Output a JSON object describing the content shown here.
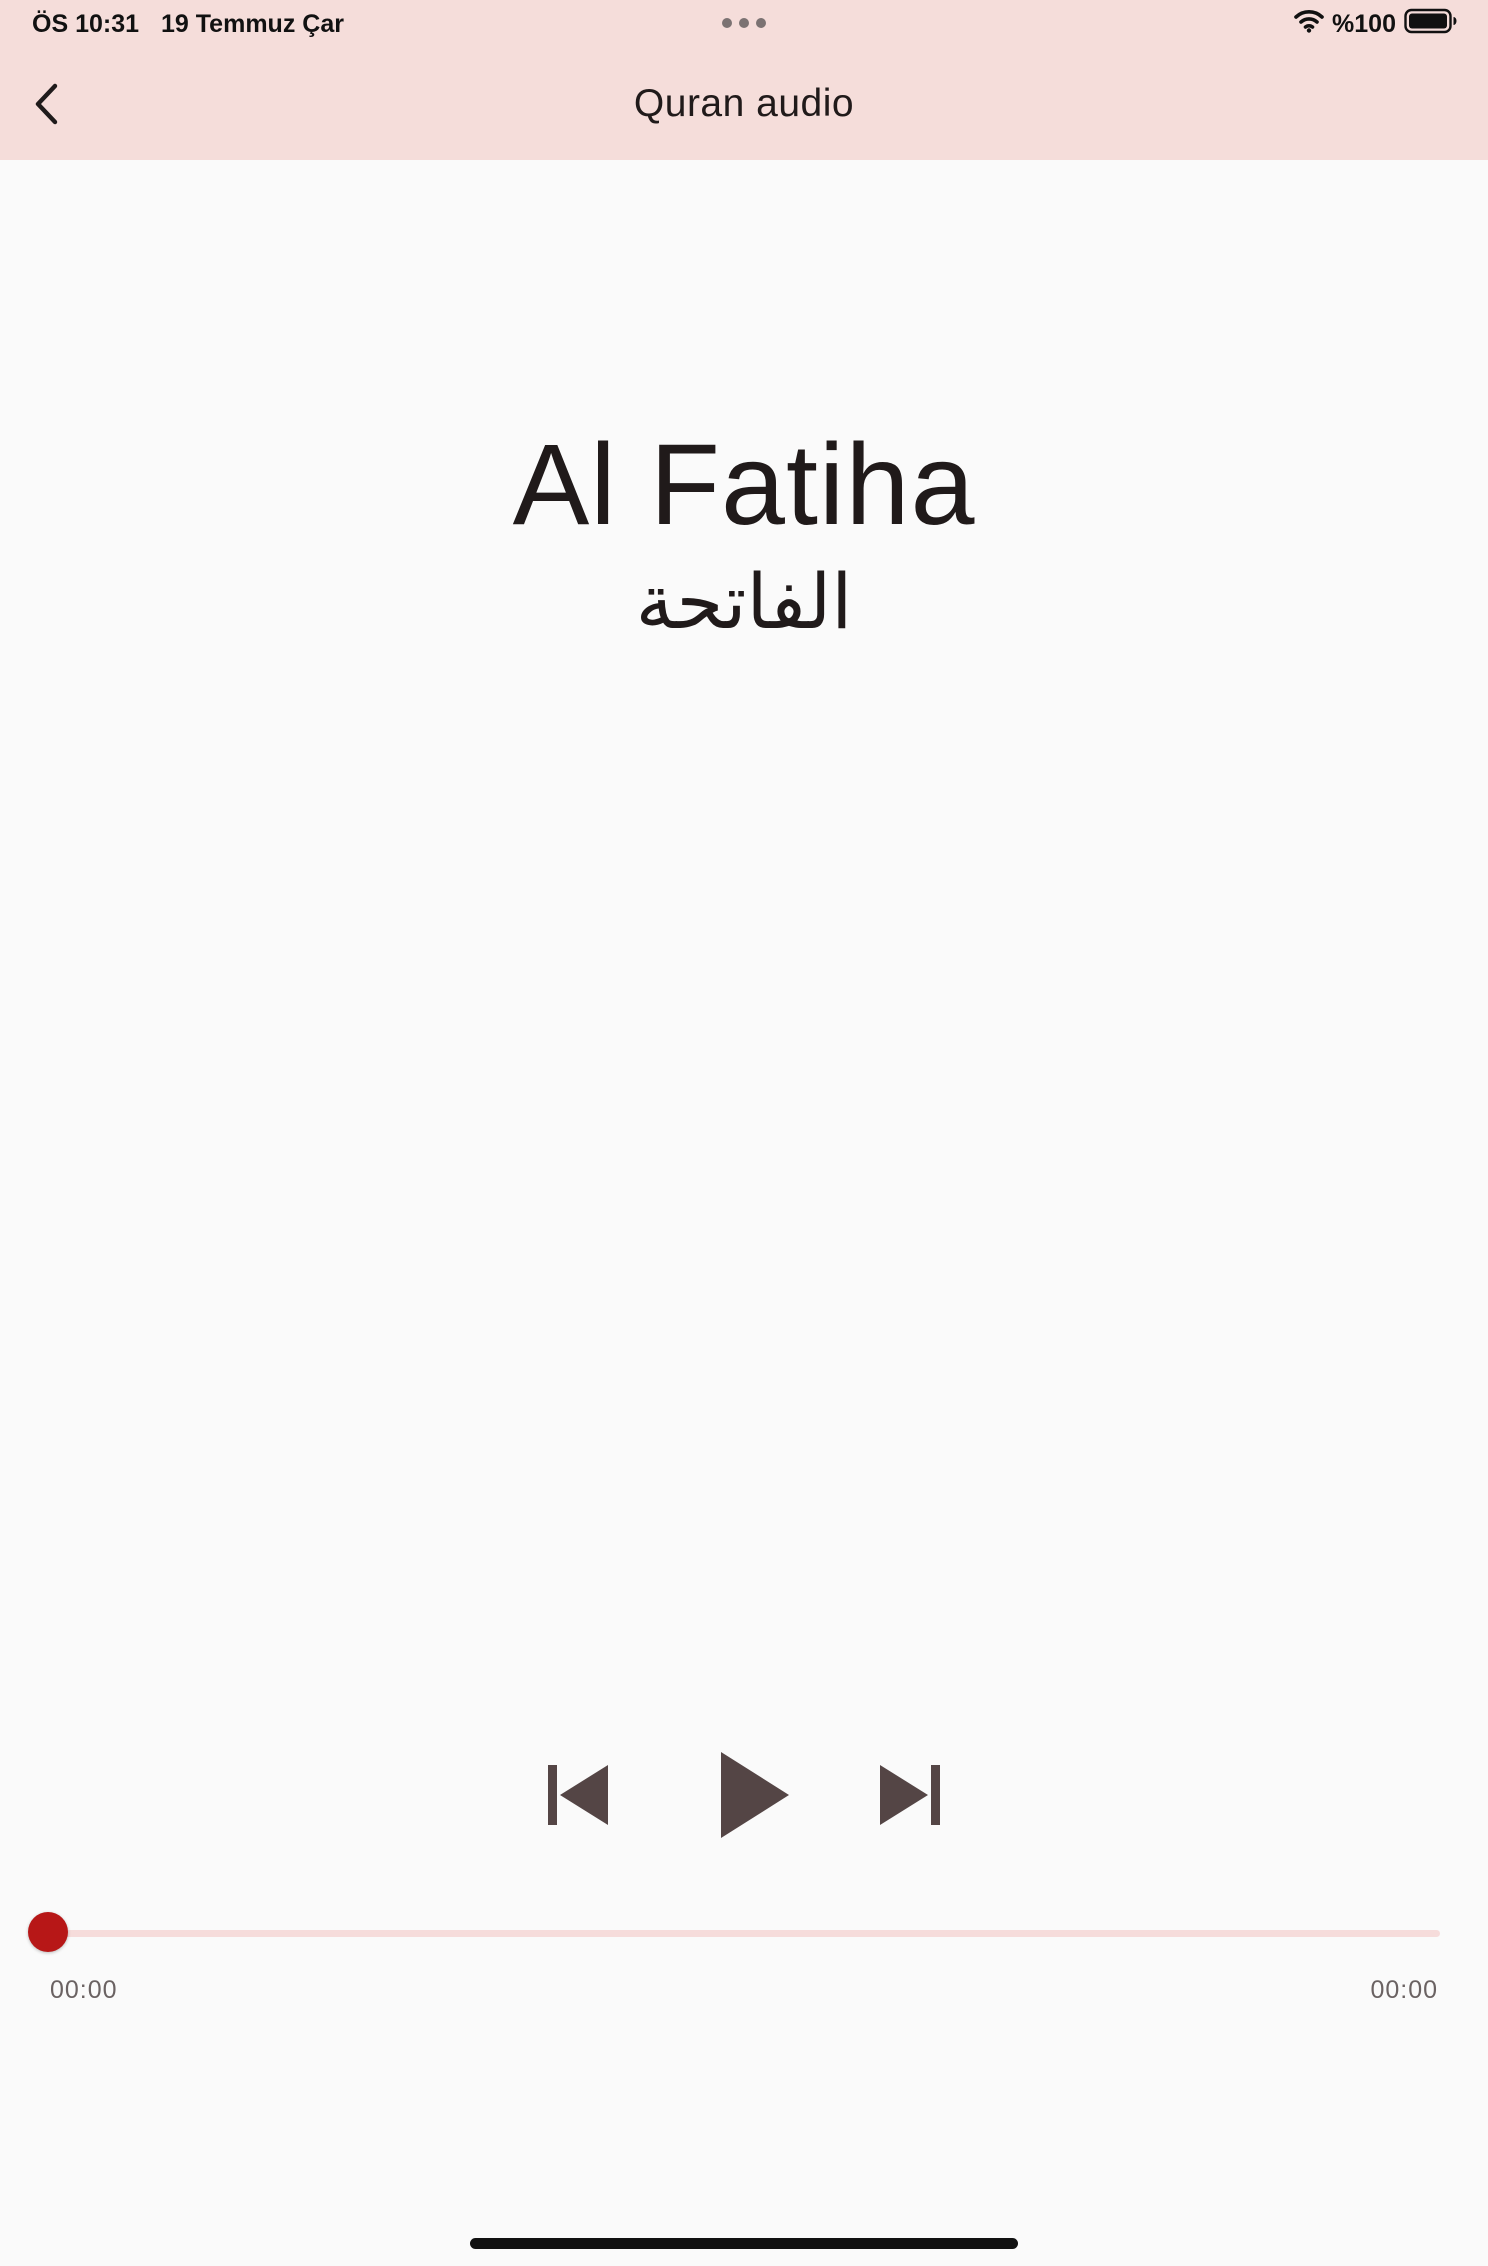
{
  "status_bar": {
    "time": "ÖS 10:31",
    "date": "19 Temmuz Çar",
    "battery": "%100",
    "icons": [
      "multitasking-dots-icon",
      "wifi-icon",
      "battery-icon"
    ]
  },
  "appbar": {
    "title": "Quran audio",
    "background": "#f5ddda",
    "back_icon": "chevron-left-icon"
  },
  "track": {
    "title": "Al Fatiha",
    "arabic_title": "الفاتحة"
  },
  "controls": {
    "icons": [
      "skip-previous-icon",
      "play-icon",
      "skip-next-icon"
    ],
    "icon_color": "#544545"
  },
  "progress": {
    "position": "00:00",
    "duration": "00:00",
    "value": 0,
    "accent_color": "#b71717",
    "track_color": "#f6dcdb"
  }
}
